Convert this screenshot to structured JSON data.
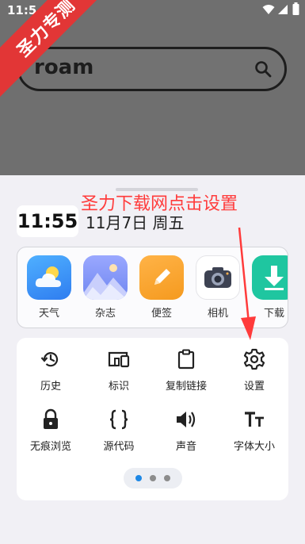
{
  "statusbar": {
    "time": "11:5"
  },
  "banner": {
    "text": "圣力专测",
    "color": "#e23636"
  },
  "search": {
    "query": "roam"
  },
  "sheet": {
    "annotation": "圣力下载网点击设置",
    "clock": "11:55",
    "date": "11月7日 周五"
  },
  "apps": [
    {
      "label": "天气",
      "icon": "weather-icon"
    },
    {
      "label": "杂志",
      "icon": "magazine-icon"
    },
    {
      "label": "便签",
      "icon": "notes-icon"
    },
    {
      "label": "相机",
      "icon": "camera-icon"
    },
    {
      "label": "下载",
      "icon": "download-icon"
    }
  ],
  "menu": {
    "items": [
      {
        "label": "历史",
        "icon": "history-icon"
      },
      {
        "label": "标识",
        "icon": "devices-icon"
      },
      {
        "label": "复制链接",
        "icon": "clipboard-icon"
      },
      {
        "label": "设置",
        "icon": "gear-icon"
      },
      {
        "label": "无痕浏览",
        "icon": "lock-icon"
      },
      {
        "label": "源代码",
        "icon": "code-braces-icon"
      },
      {
        "label": "声音",
        "icon": "speaker-icon"
      },
      {
        "label": "字体大小",
        "icon": "font-size-icon"
      }
    ],
    "pager": {
      "pages": 3,
      "current": 1
    }
  },
  "colors": {
    "accent": "#1e88e5",
    "annotation": "#ff3b3b",
    "overlay": "#6f6f6f",
    "sheet": "#f1f0f5"
  }
}
